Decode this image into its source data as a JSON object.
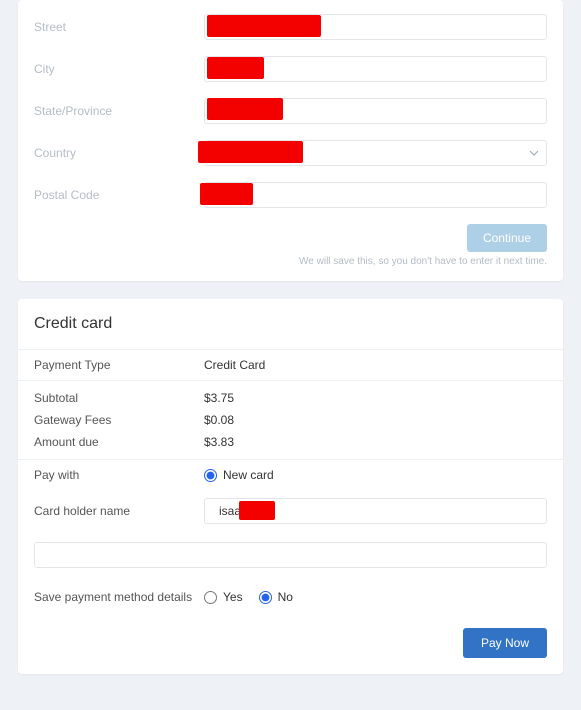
{
  "address": {
    "street_label": "Street",
    "city_label": "City",
    "state_label": "State/Province",
    "country_label": "Country",
    "postal_label": "Postal Code",
    "continue_label": "Continue",
    "helper_text": "We will save this, so you don't have to enter it next time."
  },
  "payment": {
    "title": "Credit card",
    "type_label": "Payment Type",
    "type_value": "Credit Card",
    "subtotal_label": "Subtotal",
    "subtotal_value": "$3.75",
    "fees_label": "Gateway Fees",
    "fees_value": "$0.08",
    "due_label": "Amount due",
    "due_value": "$3.83",
    "paywith_label": "Pay with",
    "paywith_option": "New card",
    "cardholder_label": "Card holder name",
    "cardholder_value": "isaac",
    "save_label": "Save payment method details",
    "save_yes": "Yes",
    "save_no": "No",
    "paynow_label": "Pay Now"
  }
}
